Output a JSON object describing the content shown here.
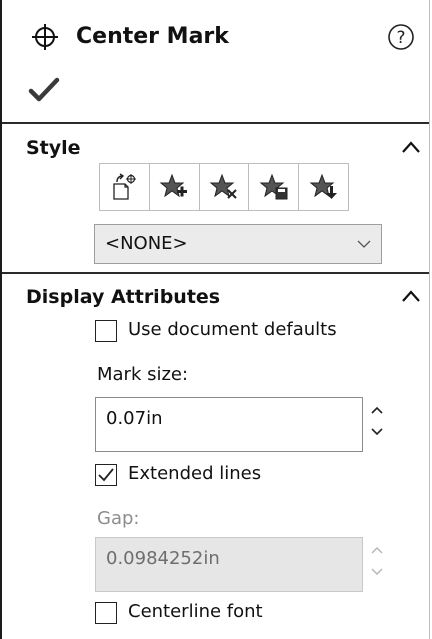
{
  "header": {
    "title": "Center Mark",
    "icon": "center-mark-icon",
    "help_icon": "help-icon",
    "ok_icon": "checkmark-icon"
  },
  "style": {
    "title": "Style",
    "toolbar_icons": [
      "apply-style-icon",
      "add-style-icon",
      "delete-style-icon",
      "save-style-icon",
      "load-style-icon"
    ],
    "selected_style": "<NONE>"
  },
  "display_attributes": {
    "title": "Display Attributes",
    "use_document_defaults": {
      "label": "Use document defaults",
      "checked": false
    },
    "mark_size": {
      "label": "Mark size:",
      "value": "0.07in"
    },
    "extended_lines": {
      "label": "Extended lines",
      "checked": true
    },
    "gap": {
      "label": "Gap:",
      "value": "0.0984252in",
      "enabled": false
    },
    "centerline_font": {
      "label": "Centerline font",
      "checked": false
    }
  },
  "colors": {
    "separator": "#2b2b2b",
    "disabled_text": "#8d8d8d",
    "disabled_bg": "#e6e6e6",
    "select_bg": "#ebebeb"
  }
}
